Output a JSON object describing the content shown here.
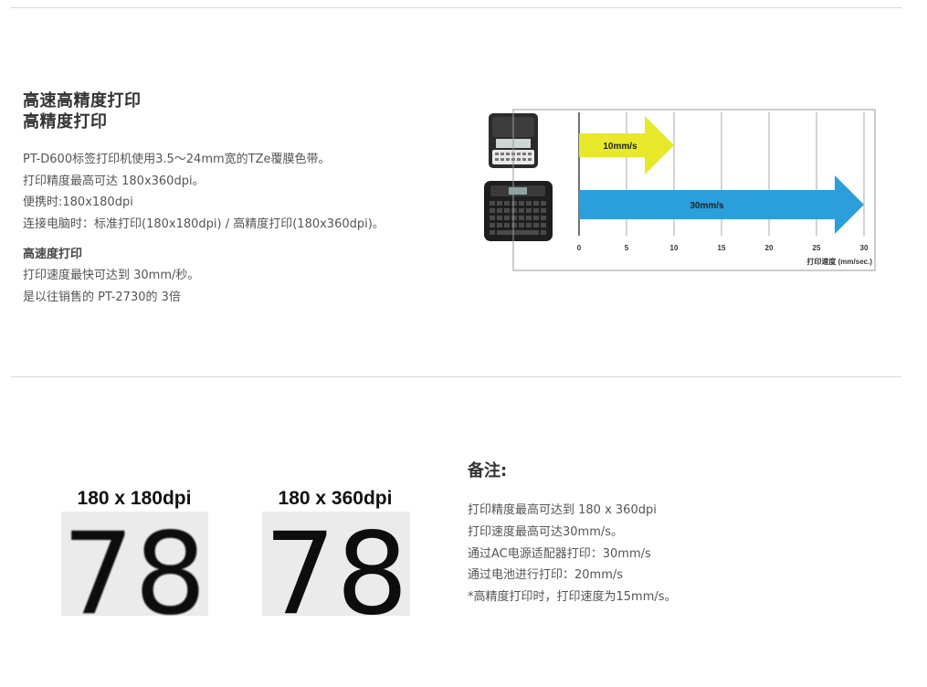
{
  "section1": {
    "heading_line1": "高速高精度打印",
    "heading_line2": "高精度打印",
    "lines": [
      "PT-D600标签打印机使用3.5～24mm宽的TZe覆膜色带。",
      "打印精度最高可达 180x360dpi。",
      "便携时:180x180dpi",
      "连接电脑时：标准打印(180x180dpi) / 高精度打印(180x360dpi)。"
    ],
    "subheading": "高速度打印",
    "sub_lines": [
      "打印速度最快可达到 30mm/秒。",
      "是以往销售的 PT-2730的 3倍"
    ]
  },
  "chart_data": {
    "type": "bar",
    "orientation": "horizontal",
    "series": [
      {
        "name": "10mm/s",
        "value": 10,
        "color": "#e6e829"
      },
      {
        "name": "30mm/s",
        "value": 30,
        "color": "#2a9fdb"
      }
    ],
    "x_ticks": [
      "0",
      "5",
      "10",
      "15",
      "20",
      "25",
      "30"
    ],
    "xlim": [
      0,
      30
    ],
    "xlabel": "打印速度 (mm/sec.)",
    "grid": true
  },
  "dpi_samples": [
    {
      "label": "180 x 180dpi",
      "digits": "78"
    },
    {
      "label": "180 x 360dpi",
      "digits": "78"
    }
  ],
  "note": {
    "title": "备注:",
    "lines": [
      "打印精度最高可达到 180 x 360dpi",
      "打印速度最高可达30mm/s。",
      "通过AC电源适配器打印：30mm/s",
      "通过电池进行打印：20mm/s",
      "*高精度打印时，打印速度为15mm/s。"
    ]
  }
}
